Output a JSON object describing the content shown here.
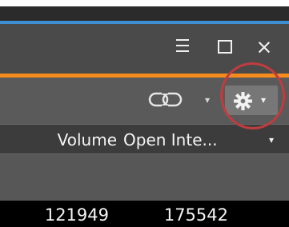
{
  "window": {
    "menu_icon": "menu-icon",
    "maximize_icon": "maximize-icon",
    "close_label": "×",
    "accent_colors": {
      "blue": "#3e8fd1",
      "orange": "#f58a1f",
      "highlight": "#bf3c3f"
    }
  },
  "toolbar": {
    "link_icon": "link-icon",
    "link_dropdown": "▾",
    "settings_icon": "gear-icon",
    "settings_dropdown": "▾"
  },
  "table": {
    "columns": [
      {
        "label": "Volume"
      },
      {
        "label": "Open Inte..."
      }
    ],
    "column_menu_caret": "▾",
    "rows": [
      {
        "volume": "121949",
        "open_interest": "175542"
      }
    ]
  }
}
